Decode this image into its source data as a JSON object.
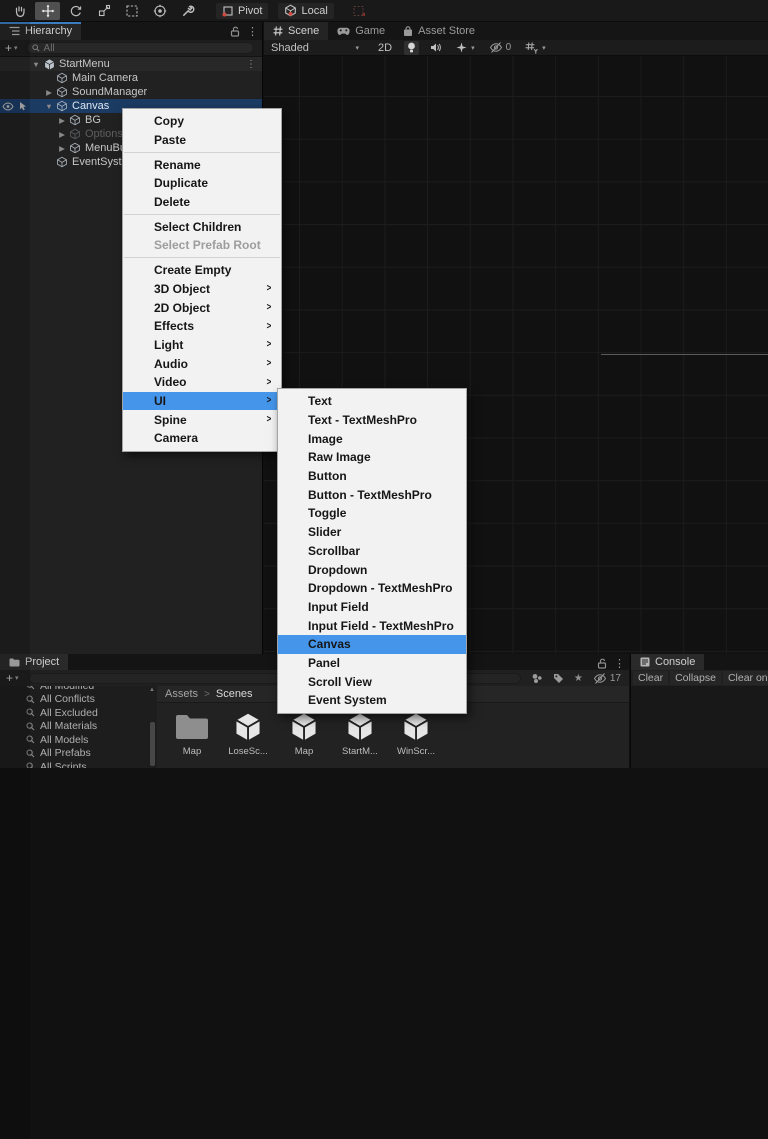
{
  "toolbar": {
    "pivot_label": "Pivot",
    "local_label": "Local"
  },
  "hierarchy": {
    "tab_label": "Hierarchy",
    "search_placeholder": "All",
    "rows": [
      {
        "label": "StartMenu",
        "level": 0,
        "arrow": "expanded",
        "icon": "scene",
        "kebab": true,
        "header": true
      },
      {
        "label": "Main Camera",
        "level": 1,
        "arrow": "none",
        "icon": "go"
      },
      {
        "label": "SoundManager",
        "level": 1,
        "arrow": "collapsed",
        "icon": "go"
      },
      {
        "label": "Canvas",
        "level": 1,
        "arrow": "expanded",
        "icon": "go",
        "selected": true,
        "gutter": true
      },
      {
        "label": "BG",
        "level": 2,
        "arrow": "collapsed",
        "icon": "go"
      },
      {
        "label": "OptionsM",
        "level": 2,
        "arrow": "collapsed",
        "icon": "go",
        "disabled": true
      },
      {
        "label": "MenuBut",
        "level": 2,
        "arrow": "collapsed",
        "icon": "go"
      },
      {
        "label": "EventSyste",
        "level": 1,
        "arrow": "none",
        "icon": "go"
      }
    ]
  },
  "scene": {
    "tabs": [
      {
        "label": "Scene",
        "icon": "grid",
        "active": true
      },
      {
        "label": "Game",
        "icon": "gamepad"
      },
      {
        "label": "Asset Store",
        "icon": "bag"
      }
    ],
    "draw_mode": "Shaded",
    "mode_2d": "2D",
    "hidden_count": "0"
  },
  "context_menu": {
    "items": [
      {
        "type": "item",
        "label": "Copy"
      },
      {
        "type": "item",
        "label": "Paste"
      },
      {
        "type": "separator"
      },
      {
        "type": "item",
        "label": "Rename"
      },
      {
        "type": "item",
        "label": "Duplicate"
      },
      {
        "type": "item",
        "label": "Delete"
      },
      {
        "type": "separator"
      },
      {
        "type": "item",
        "label": "Select Children"
      },
      {
        "type": "item",
        "label": "Select Prefab Root",
        "disabled": true
      },
      {
        "type": "separator"
      },
      {
        "type": "item",
        "label": "Create Empty"
      },
      {
        "type": "item",
        "label": "3D Object",
        "arrow": true
      },
      {
        "type": "item",
        "label": "2D Object",
        "arrow": true
      },
      {
        "type": "item",
        "label": "Effects",
        "arrow": true
      },
      {
        "type": "item",
        "label": "Light",
        "arrow": true
      },
      {
        "type": "item",
        "label": "Audio",
        "arrow": true
      },
      {
        "type": "item",
        "label": "Video",
        "arrow": true
      },
      {
        "type": "item",
        "label": "UI",
        "arrow": true,
        "highlight": true
      },
      {
        "type": "item",
        "label": "Spine",
        "arrow": true
      },
      {
        "type": "item",
        "label": "Camera"
      }
    ]
  },
  "ui_submenu": {
    "items": [
      {
        "type": "item",
        "label": "Text"
      },
      {
        "type": "item",
        "label": "Text - TextMeshPro"
      },
      {
        "type": "item",
        "label": "Image"
      },
      {
        "type": "item",
        "label": "Raw Image"
      },
      {
        "type": "item",
        "label": "Button"
      },
      {
        "type": "item",
        "label": "Button - TextMeshPro"
      },
      {
        "type": "item",
        "label": "Toggle"
      },
      {
        "type": "item",
        "label": "Slider"
      },
      {
        "type": "item",
        "label": "Scrollbar"
      },
      {
        "type": "item",
        "label": "Dropdown"
      },
      {
        "type": "item",
        "label": "Dropdown - TextMeshPro"
      },
      {
        "type": "item",
        "label": "Input Field"
      },
      {
        "type": "item",
        "label": "Input Field - TextMeshPro"
      },
      {
        "type": "item",
        "label": "Canvas",
        "highlight": true
      },
      {
        "type": "item",
        "label": "Panel"
      },
      {
        "type": "item",
        "label": "Scroll View"
      },
      {
        "type": "item",
        "label": "Event System"
      }
    ]
  },
  "project": {
    "tab_label": "Project",
    "favorites": [
      "All Modified",
      "All Conflicts",
      "All Excluded",
      "All Materials",
      "All Models",
      "All Prefabs",
      "All Scripts"
    ],
    "breadcrumb": {
      "root": "Assets",
      "separator": ">",
      "current": "Scenes"
    },
    "files": [
      {
        "type": "folder",
        "label": "Map"
      },
      {
        "type": "scene",
        "label": "LoseSc..."
      },
      {
        "type": "scene",
        "label": "Map"
      },
      {
        "type": "scene",
        "label": "StartM..."
      },
      {
        "type": "scene",
        "label": "WinScr..."
      }
    ],
    "hidden_count": "17"
  },
  "console": {
    "tab_label": "Console",
    "buttons": [
      "Clear",
      "Collapse",
      "Clear on Play"
    ]
  },
  "icons": {
    "kebab": "⋮",
    "dropdown_arrow": "▾",
    "expand": "▶",
    "collapse": "▼",
    "star": "★",
    "plus": "+",
    "submenu_arrow": ">",
    "scroll_up": "▲"
  }
}
